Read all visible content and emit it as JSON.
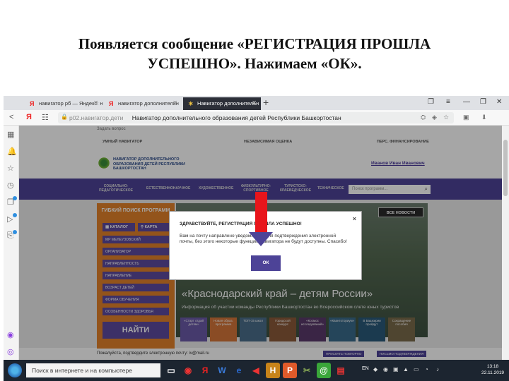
{
  "slide": {
    "title_line1": "Появляется сообщение «РЕГИСТРАЦИЯ ПРОШЛА",
    "title_line2": "УСПЕШНО». Нажимаем  «ОК»."
  },
  "browser": {
    "tabs": [
      {
        "label": "навигатор рб — Яндекс: н",
        "favicon": "Я"
      },
      {
        "label": "навигатор дополнительн",
        "favicon": "Я"
      },
      {
        "label": "Навигатор дополнительн",
        "favicon": "✶"
      }
    ],
    "url": "p02.навигатор.дети",
    "page_title": "Навигатор дополнительного образования детей Республики Башкортостан"
  },
  "site": {
    "ask_label": "Задать вопрос",
    "top_links": [
      "УМНЫЙ НАВИГАТОР",
      "НЕЗАВИСИМАЯ ОЦЕНКА",
      "ПЕРС. ФИНАНСИРОВАНИЕ"
    ],
    "logo_text": "НАВИГАТОР ДОПОЛНИТЕЛЬНОГО ОБРАЗОВАНИЯ ДЕТЕЙ РЕСПУБЛИКИ БАШКОРТОСТАН",
    "user_name": "Иванов Иван Иванович",
    "menu": [
      "СОЦИАЛЬНО-ПЕДАГОГИЧЕСКОЕ",
      "ЕСТЕСТВЕННОНАУЧНОЕ",
      "ХУДОЖЕСТВЕННОЕ",
      "ФИЗКУЛЬТУРНО-СПОРТИВНОЕ",
      "ТУРИСТСКО-КРАЕВЕДЧЕСКОЕ",
      "ТЕХНИЧЕСКОЕ"
    ],
    "search_placeholder": "Поиск программ...",
    "filter": {
      "title": "ГИБКИЙ ПОИСК ПРОГРАММ",
      "tab_catalog": "КАТАЛОГ",
      "tab_map": "КАРТА",
      "selects": [
        "МР МЕЛЕУЗОВСКИЙ",
        "ОРГАНИЗАТОР",
        "НАПРАВЛЕННОСТЬ",
        "НАПРАВЛЕНИЕ",
        "ВОЗРАСТ ДЕТЕЙ",
        "ФОРМА ОБУЧЕНИЯ",
        "ОСОБЕННОСТИ ЗДОРОВЬЯ"
      ],
      "find_label": "НАЙТИ"
    },
    "hero": {
      "all_news": "ВСЕ НОВОСТИ",
      "title": "«Краснодарский край – детям России»",
      "subtitle": "Информация об участии команды Республики Башкортостан во Всероссийском слете юных туристов"
    },
    "tiles": [
      "«Старт отдай детям»",
      "Новая образ. программа",
      "ТОП-15 школ",
      "Городской конкурс",
      "«Космос исследований»",
      "«Квантоториум»",
      "В Башкирии пройдут",
      "Сокращение пособия"
    ],
    "confirm_note": "Пожалуйста, подтвердите электронную почту: iv@mail.ru",
    "resend_btn": "ПРИСЛАТЬ ПОВТОРНО",
    "change_btn": "ПИСЬМО ПОДТВЕРЖДЕНИЯ"
  },
  "dialog": {
    "title": "ЗДРАВСТВУЙТЕ, РЕГИСТРАЦИЯ ПРОШЛА УСПЕШНО!",
    "body": "Вам на почту направлено уведомление для подтверждения электронной почты, без этого некоторые функции Навигатора не будут доступны. Спасибо!",
    "ok_label": "ОК",
    "close_label": "×"
  },
  "taskbar": {
    "search_placeholder": "Поиск в интернете и на компьютере",
    "lang": "EN",
    "time": "13:18",
    "date": "22.11.2019"
  },
  "colors": {
    "brand_purple": "#4d4397",
    "filter_orange": "#e2822a",
    "arrow_red": "#e8151b"
  }
}
